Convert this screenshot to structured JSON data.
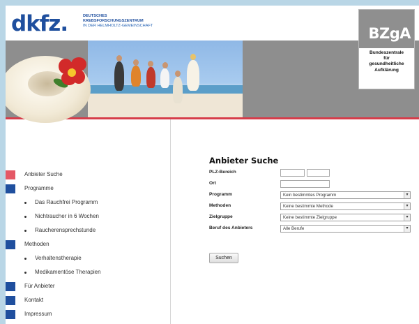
{
  "header": {
    "dkfz_logo": "dkfz.",
    "dkfz_line1": "DEUTSCHES",
    "dkfz_line2": "KREBSFORSCHUNGSZENTRUM",
    "dkfz_line3": "IN DER HELMHOLTZ-GEMEINSCHAFT",
    "bzga_logo": "BZgA",
    "bzga_line1": "Bundeszentrale",
    "bzga_line2": "für",
    "bzga_line3": "gesundheitliche",
    "bzga_line4": "Aufklärung"
  },
  "colors": {
    "brand_blue": "#1f4f9e",
    "active_red": "#e45865",
    "banner_gray": "#8e8e8e",
    "accent_line": "#d63d4a"
  },
  "sidebar": {
    "items": [
      {
        "label": "Anbieter Suche",
        "type": "main",
        "active": true
      },
      {
        "label": "Programme",
        "type": "main",
        "active": false
      },
      {
        "label": "Das Rauchfrei Programm",
        "type": "sub"
      },
      {
        "label": "Nichtraucher in 6 Wochen",
        "type": "sub"
      },
      {
        "label": "Raucherensprechstunde",
        "type": "sub"
      },
      {
        "label": "Methoden",
        "type": "main",
        "active": false
      },
      {
        "label": "Verhaltenstherapie",
        "type": "sub"
      },
      {
        "label": "Medikamentöse Therapien",
        "type": "sub"
      },
      {
        "label": "Für Anbieter",
        "type": "main",
        "active": false
      },
      {
        "label": "Kontakt",
        "type": "main",
        "active": false
      },
      {
        "label": "Impressum",
        "type": "main",
        "active": false
      }
    ]
  },
  "form": {
    "title": "Anbieter Suche",
    "plz_label": "PLZ-Bereich",
    "plz_from": "",
    "plz_to": "",
    "ort_label": "Ort",
    "ort_value": "",
    "programm_label": "Programm",
    "programm_value": "Kein bestimmtes Programm",
    "methoden_label": "Methoden",
    "methoden_value": "Keine bestimmte Methode",
    "zielgruppe_label": "Zielgruppe",
    "zielgruppe_value": "Keine bestimmte Zielgruppe",
    "beruf_label": "Beruf des Anbieters",
    "beruf_value": "Alle Berufe",
    "dropdown_arrow": "▾",
    "search_button": "Suchen"
  }
}
